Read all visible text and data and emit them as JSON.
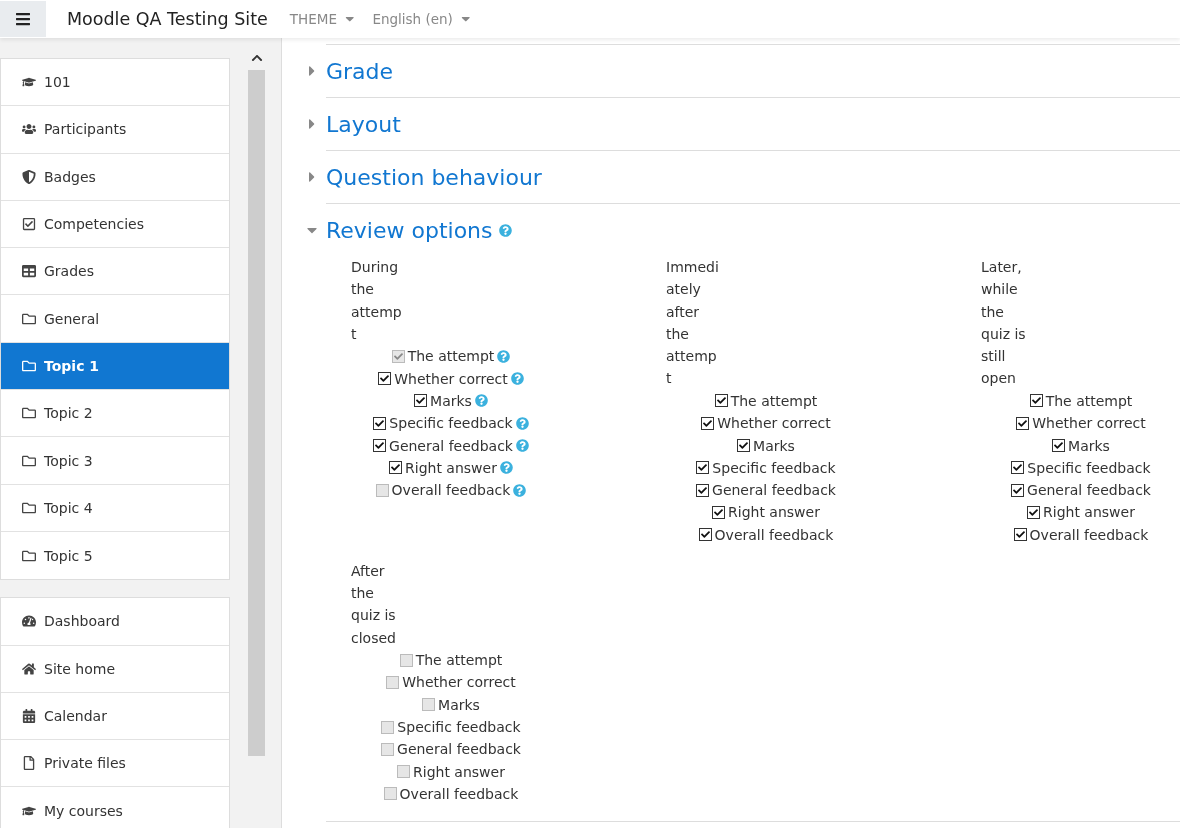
{
  "header": {
    "site_name": "Moodle QA Testing Site",
    "menus": [
      "THEME",
      "English (en)"
    ]
  },
  "sidebar": {
    "groups": [
      {
        "items": [
          {
            "label": "101",
            "selected": false
          },
          {
            "label": "Participants",
            "selected": false
          },
          {
            "label": "Badges",
            "selected": false
          },
          {
            "label": "Competencies",
            "selected": false
          },
          {
            "label": "Grades",
            "selected": false
          },
          {
            "label": "General",
            "selected": false
          },
          {
            "label": "Topic 1",
            "selected": true
          },
          {
            "label": "Topic 2",
            "selected": false
          },
          {
            "label": "Topic 3",
            "selected": false
          },
          {
            "label": "Topic 4",
            "selected": false
          },
          {
            "label": "Topic 5",
            "selected": false
          }
        ]
      },
      {
        "items": [
          {
            "label": "Dashboard",
            "selected": false
          },
          {
            "label": "Site home",
            "selected": false
          },
          {
            "label": "Calendar",
            "selected": false
          },
          {
            "label": "Private files",
            "selected": false
          },
          {
            "label": "My courses",
            "selected": false
          }
        ]
      }
    ]
  },
  "sections": [
    {
      "title": "Grade",
      "expanded": false,
      "help": false
    },
    {
      "title": "Layout",
      "expanded": false,
      "help": false
    },
    {
      "title": "Question behaviour",
      "expanded": false,
      "help": false
    },
    {
      "title": "Review options",
      "expanded": true,
      "help": true
    }
  ],
  "review_columns": [
    {
      "heading": "During the attempt",
      "help": true,
      "options": [
        {
          "label": "The attempt",
          "checked": true,
          "disabled": true
        },
        {
          "label": "Whether correct",
          "checked": true,
          "disabled": false
        },
        {
          "label": "Marks",
          "checked": true,
          "disabled": false
        },
        {
          "label": "Specific feedback",
          "checked": true,
          "disabled": false
        },
        {
          "label": "General feedback",
          "checked": true,
          "disabled": false
        },
        {
          "label": "Right answer",
          "checked": true,
          "disabled": false
        },
        {
          "label": "Overall feedback",
          "checked": false,
          "disabled": true
        }
      ]
    },
    {
      "heading": "Immediately after the attempt",
      "help": false,
      "options": [
        {
          "label": "The attempt",
          "checked": true,
          "disabled": false
        },
        {
          "label": "Whether correct",
          "checked": true,
          "disabled": false
        },
        {
          "label": "Marks",
          "checked": true,
          "disabled": false
        },
        {
          "label": "Specific feedback",
          "checked": true,
          "disabled": false
        },
        {
          "label": "General feedback",
          "checked": true,
          "disabled": false
        },
        {
          "label": "Right answer",
          "checked": true,
          "disabled": false
        },
        {
          "label": "Overall feedback",
          "checked": true,
          "disabled": false
        }
      ]
    },
    {
      "heading": "Later, while the quiz is still open",
      "help": false,
      "options": [
        {
          "label": "The attempt",
          "checked": true,
          "disabled": false
        },
        {
          "label": "Whether correct",
          "checked": true,
          "disabled": false
        },
        {
          "label": "Marks",
          "checked": true,
          "disabled": false
        },
        {
          "label": "Specific feedback",
          "checked": true,
          "disabled": false
        },
        {
          "label": "General feedback",
          "checked": true,
          "disabled": false
        },
        {
          "label": "Right answer",
          "checked": true,
          "disabled": false
        },
        {
          "label": "Overall feedback",
          "checked": true,
          "disabled": false
        }
      ]
    },
    {
      "heading": "After the quiz is closed",
      "help": false,
      "options": [
        {
          "label": "The attempt",
          "checked": false,
          "disabled": true
        },
        {
          "label": "Whether correct",
          "checked": false,
          "disabled": true
        },
        {
          "label": "Marks",
          "checked": false,
          "disabled": true
        },
        {
          "label": "Specific feedback",
          "checked": false,
          "disabled": true
        },
        {
          "label": "General feedback",
          "checked": false,
          "disabled": true
        },
        {
          "label": "Right answer",
          "checked": false,
          "disabled": true
        },
        {
          "label": "Overall feedback",
          "checked": false,
          "disabled": true
        }
      ]
    }
  ]
}
